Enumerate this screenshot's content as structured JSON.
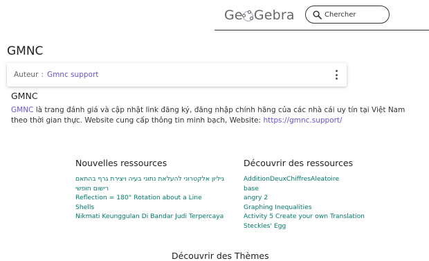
{
  "header": {
    "logo_parts": [
      "Ge",
      "Gebra"
    ],
    "search_placeholder": "Chercher"
  },
  "page": {
    "title": "GMNC",
    "author_label": "Auteur",
    "author_separator": ":",
    "author_name": "Gmnc support"
  },
  "section": {
    "title": "GMNC",
    "desc_link": "GMNC",
    "desc_text": " là trang đánh giá và cập nhật link đăng ký, đăng nhập chính hãng của các nhà cái uy tín tại Việt Nam theo thời gian thực. Website cung cấp thông tin minh bạch, Website: ",
    "desc_url": "https://gmnc.support/"
  },
  "new_resources": {
    "title": "Nouvelles ressources",
    "items": [
      "גיליון אלקטרוני להעלאת נתוני בעיה ויצירת גרף בהתאם",
      "רישום חופשי",
      "Reflection = 180° Rotation about a Line",
      "Shells",
      "Nikmati Keunggulan Di Bandar Judi Terpercaya"
    ]
  },
  "discover": {
    "title": "Découvrir des ressources",
    "items": [
      "AdditionDeuxChiffresAleatoire",
      "base",
      "angry 2",
      "Graphing Inequalities",
      "Activity 5 Create your own Translation",
      "Steckles' Egg"
    ]
  },
  "footer": {
    "heading": "Découvrir des Thèmes"
  }
}
